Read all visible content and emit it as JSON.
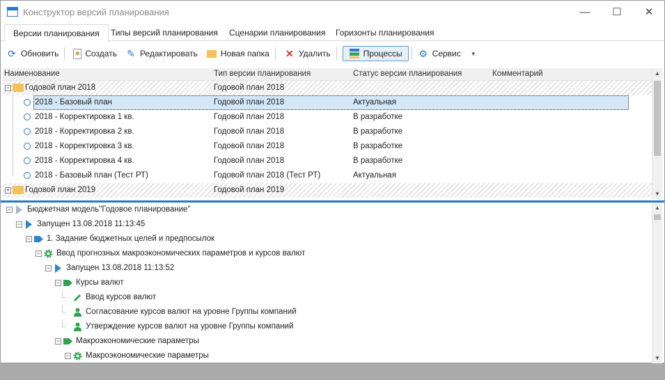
{
  "window": {
    "title": "Конструктор версий планирования",
    "minimize": "—",
    "maximize": "☐",
    "close": "✕"
  },
  "tabs": [
    {
      "label": "Версии планирования",
      "active": true
    },
    {
      "label": "Типы версий планирования"
    },
    {
      "label": "Сценарии планирования"
    },
    {
      "label": "Горизонты планирования"
    }
  ],
  "toolbar": {
    "refresh": "Обновить",
    "create": "Создать",
    "edit": "Редактировать",
    "new_folder": "Новая папка",
    "delete": "Удалить",
    "processes": "Процессы",
    "service": "Сервис"
  },
  "grid": {
    "columns": [
      "Наименование",
      "Тип версии планирования",
      "Статус версии планирования",
      "Комментарий"
    ],
    "rows": [
      {
        "kind": "group",
        "expanded": true,
        "name": "Годовой план 2018",
        "type": "Годовой план 2018",
        "status": ""
      },
      {
        "kind": "item",
        "name": "2018 - Базовый план",
        "type": "Годовой план 2018",
        "status": "Актуальная",
        "selected": true
      },
      {
        "kind": "item",
        "name": "2018 - Корректировка 1 кв.",
        "type": "Годовой план 2018",
        "status": "В разработке"
      },
      {
        "kind": "item",
        "name": "2018 - Корректировка 2 кв.",
        "type": "Годовой план 2018",
        "status": "В разработке"
      },
      {
        "kind": "item",
        "name": "2018 - Корректировка 3 кв.",
        "type": "Годовой план 2018",
        "status": "В разработке"
      },
      {
        "kind": "item",
        "name": "2018 - Корректировка 4 кв.",
        "type": "Годовой план 2018",
        "status": "В разработке"
      },
      {
        "kind": "item",
        "name": "2018 - Базовый план (Тест РТ)",
        "type": "Годовой план 2018 (Тест РТ)",
        "status": "Актуальная"
      },
      {
        "kind": "group",
        "expanded": false,
        "name": "Годовой план 2019",
        "type": "Годовой план 2019",
        "status": ""
      }
    ]
  },
  "tree": [
    {
      "level": 0,
      "icon": "play-gray",
      "label": "Бюджетная модель\"Годовое планирование\"",
      "expander": true
    },
    {
      "level": 1,
      "icon": "play-blue",
      "label": "Запущен 13.08.2018 11:13:45",
      "expander": true
    },
    {
      "level": 2,
      "icon": "tag-blue",
      "label": "1. Задание бюджетных целей и предпосылок",
      "expander": true
    },
    {
      "level": 3,
      "icon": "gear-green",
      "label": "Ввод прогнозных макроэкономических параметров и курсов валют",
      "expander": true
    },
    {
      "level": 4,
      "icon": "play-blue",
      "label": "Запущен 13.08.2018 11:13:52",
      "expander": true
    },
    {
      "level": 5,
      "icon": "tag-green",
      "label": "Курсы валют",
      "expander": true
    },
    {
      "level": 6,
      "icon": "pencil-green",
      "label": "Ввод курсов валют",
      "expander": false
    },
    {
      "level": 6,
      "icon": "user-green",
      "label": "Согласование курсов валют на уровне Группы компаний",
      "expander": false
    },
    {
      "level": 6,
      "icon": "user-green",
      "label": "Утверждение курсов валют на уровне Группы компаний",
      "expander": false
    },
    {
      "level": 5,
      "icon": "tag-green",
      "label": "Макроэкономические параметры",
      "expander": true
    },
    {
      "level": 6,
      "icon": "gear-green",
      "label": "Макроэкономические параметры",
      "expander": true
    }
  ],
  "colors": {
    "accent": "#1e7ad0",
    "green": "#2ea44f",
    "selection": "#d4e7f7"
  }
}
